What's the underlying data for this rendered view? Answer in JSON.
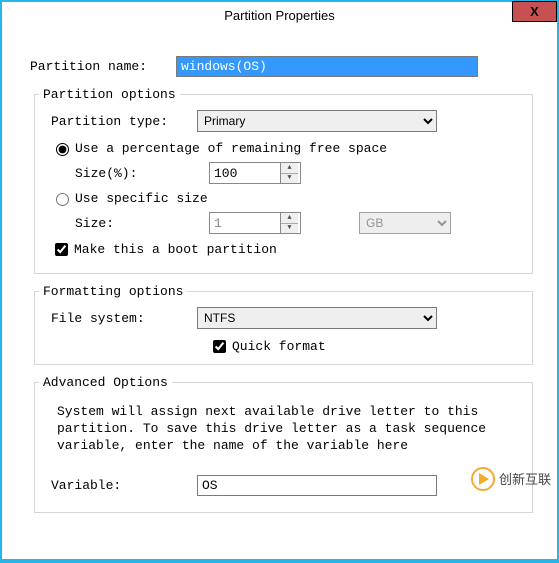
{
  "title": "Partition Properties",
  "close_glyph": "X",
  "name_label": "Partition name:",
  "name_value": "windows(OS)",
  "partition_options": {
    "legend": "Partition options",
    "type_label": "Partition type:",
    "type_value": "Primary",
    "radio_percent": "Use a percentage of remaining free space",
    "percent_size_label": "Size(%):",
    "percent_size_value": "100",
    "radio_specific": "Use specific size",
    "specific_size_label": "Size:",
    "specific_size_value": "1",
    "unit_value": "GB",
    "boot_label": "Make this a boot partition"
  },
  "formatting_options": {
    "legend": "Formatting options",
    "fs_label": "File system:",
    "fs_value": "NTFS",
    "quick_format_label": "Quick format"
  },
  "advanced_options": {
    "legend": "Advanced Options",
    "description": "System will assign next available drive letter to this partition. To save this drive letter as a task sequence variable, enter the name of the variable here",
    "variable_label": "Variable:",
    "variable_value": "OS"
  },
  "watermark": "创新互联"
}
